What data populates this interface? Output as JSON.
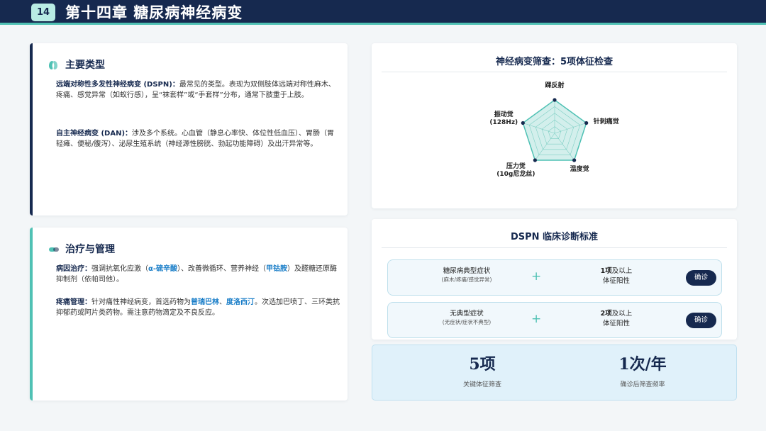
{
  "header": {
    "page_number": "14",
    "title": "第十四章 糖尿病神经病变"
  },
  "main_types": {
    "title": "主要类型",
    "icon": "kidney-icon",
    "p1_term": "远端对称性多发性神经病变 (DSPN)",
    "p1_sep": "：",
    "p1_text": "最常见的类型。表现为双侧肢体远端对称性麻木、疼痛、感觉异常（如蚁行感），呈“袜套样”或“手套样”分布，通常下肢重于上肢。",
    "p2_term": "自主神经病变 (DAN)",
    "p2_sep": "：",
    "p2_text": "涉及多个系统。心血管（静息心率快、体位性低血压）、胃肠（胃轻瘫、便秘/腹泻）、泌尿生殖系统（神经源性膀胱、勃起功能障碍）及出汗异常等。"
  },
  "treatment": {
    "title": "治疗与管理",
    "icon": "capsule-icon",
    "p1_term": "病因治疗",
    "p1_sep": "：",
    "p1_a": "强调抗氧化应激（",
    "p1_drug1": "α-硫辛酸",
    "p1_b": "）、改善微循环、营养神经（",
    "p1_drug2": "甲钴胺",
    "p1_c": "）及醛糖还原酶抑制剂（依帕司他）。",
    "p2_term": "疼痛管理",
    "p2_sep": "：",
    "p2_a": "针对痛性神经病变，首选药物为",
    "p2_drug1": "普瑞巴林",
    "p2_mid": "、",
    "p2_drug2": "度洛西汀",
    "p2_b": "。次选加巴喷丁、三环类抗抑郁药或阿片类药物。需注意药物滴定及不良反应。"
  },
  "radar": {
    "title": "神经病变筛查：5项体征检查",
    "labels": [
      "踝反射",
      "针刺痛觉",
      "温度觉",
      "压力觉\n(10g尼龙丝)",
      "振动觉\n(128Hz)"
    ],
    "levels": 5,
    "fill_color": "#4fc1b4",
    "point_color": "#16294f"
  },
  "criteria": {
    "title": "DSPN 临床诊断标准",
    "rows": [
      {
        "symptom": "糖尿病典型症状",
        "detail": "(麻木/疼痛/感觉异常)",
        "plus": "+",
        "req_count": "1项",
        "req_tail": "及以上",
        "req_line2": "体征阳性",
        "result": "确诊"
      },
      {
        "symptom": "无典型症状",
        "detail": "(无症状/症状不典型)",
        "plus": "+",
        "req_count": "2项",
        "req_tail": "及以上",
        "req_line2": "体征阳性",
        "result": "确诊"
      }
    ]
  },
  "stats": [
    {
      "value": "5项",
      "label": "关键体征筛查"
    },
    {
      "value": "1次/年",
      "label": "确诊后筛查频率"
    }
  ]
}
